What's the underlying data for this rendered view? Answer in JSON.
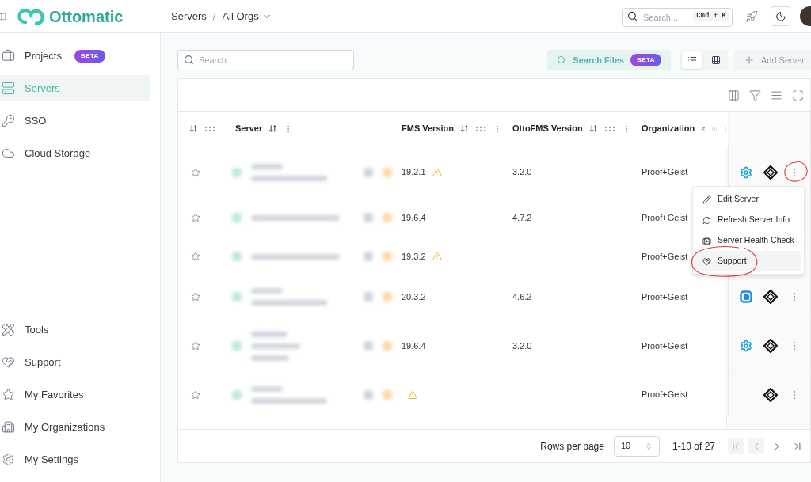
{
  "logo": {
    "text": "Ottomatic"
  },
  "breadcrumb": {
    "items": [
      {
        "label": "Servers"
      },
      {
        "label": "All Orgs"
      }
    ],
    "separator": "/"
  },
  "global_search": {
    "placeholder": "Search...",
    "shortcut": "Cmd + K"
  },
  "sidebar": {
    "items": [
      {
        "kind": "projects",
        "label": "Projects",
        "badge": "BETA",
        "selected": false
      },
      {
        "kind": "servers",
        "label": "Servers",
        "selected": true
      },
      {
        "kind": "sso",
        "label": "SSO",
        "selected": false
      },
      {
        "kind": "cloud",
        "label": "Cloud Storage",
        "selected": false
      }
    ],
    "bottom_items": [
      {
        "kind": "tools",
        "label": "Tools",
        "selected": false
      },
      {
        "kind": "support",
        "label": "Support",
        "selected": false
      },
      {
        "kind": "favorites",
        "label": "My Favorites",
        "selected": false
      },
      {
        "kind": "organizations",
        "label": "My Organizations",
        "selected": false
      },
      {
        "kind": "settings",
        "label": "My Settings",
        "selected": false
      }
    ]
  },
  "toolbar": {
    "search": {
      "placeholder": "Search"
    },
    "search_files": {
      "label": "Search Files",
      "badge": "BETA"
    },
    "view_toggle": [
      {
        "kind": "list",
        "selected": true
      },
      {
        "kind": "grid",
        "selected": false
      }
    ],
    "add_server": {
      "label": "Add Server",
      "disabled": true
    }
  },
  "table": {
    "columns": [
      {
        "label": "Server"
      },
      {
        "label": "FMS Version"
      },
      {
        "label": "OttoFMS Version"
      },
      {
        "label": "Organization"
      }
    ],
    "rows": [
      {
        "favorite": false,
        "fms_version": "19.2.1",
        "fms_warning": true,
        "ottofms_version": "3.2.0",
        "organization": "Proof+Geist",
        "host": {
          "kind": "gear"
        }
      },
      {
        "favorite": false,
        "fms_version": "19.6.4",
        "fms_warning": false,
        "ottofms_version": "4.7.2",
        "organization": "Proof+Geist"
      },
      {
        "favorite": false,
        "fms_version": "19.3.2",
        "fms_warning": true,
        "organization": "Proof+Geist"
      },
      {
        "favorite": false,
        "fms_version": "20.3.2",
        "fms_warning": false,
        "ottofms_version": "4.6.2",
        "organization": "Proof+Geist",
        "host": {
          "kind": "square"
        }
      },
      {
        "favorite": false,
        "fms_version": "19.6.4",
        "fms_warning": false,
        "ottofms_version": "3.2.0",
        "organization": "Proof+Geist",
        "host": {
          "kind": "gear"
        }
      },
      {
        "favorite": false,
        "fms_warning": true,
        "organization": "Proof+Geist"
      }
    ]
  },
  "row_menu": {
    "items": [
      {
        "kind": "edit",
        "label": "Edit Server",
        "selected": false
      },
      {
        "kind": "refresh",
        "label": "Refresh Server Info",
        "selected": false
      },
      {
        "kind": "health",
        "label": "Server Health Check",
        "selected": false
      },
      {
        "kind": "support",
        "label": "Support",
        "selected": true
      }
    ]
  },
  "pagination": {
    "rows_per_page_label": "Rows per page",
    "rows_per_page": "10",
    "range": "1-10 of 27",
    "buttons": [
      {
        "kind": "first",
        "disabled": true
      },
      {
        "kind": "prev",
        "disabled": true
      },
      {
        "kind": "next",
        "disabled": false
      },
      {
        "kind": "last",
        "disabled": false
      }
    ]
  }
}
